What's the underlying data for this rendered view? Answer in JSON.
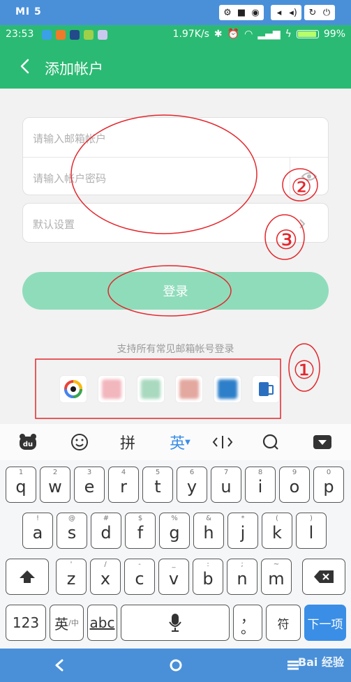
{
  "emulator": {
    "title": "MI 5"
  },
  "status_bar": {
    "time": "23:53",
    "speed": "1.97K/s",
    "battery": "99%",
    "battery_level": 0.99
  },
  "app_bar": {
    "title": "添加帐户"
  },
  "form": {
    "email_placeholder": "请输入邮箱帐户",
    "password_placeholder": "请输入帐户密码",
    "settings_label": "默认设置"
  },
  "login_button": "登录",
  "support_text": "支持所有常见邮箱帐号登录",
  "providers": [
    {
      "name": "provider-1",
      "color": "#e94335"
    },
    {
      "name": "provider-2",
      "color": "#f2b6bd"
    },
    {
      "name": "provider-3",
      "color": "#a9d9bf"
    },
    {
      "name": "provider-4",
      "color": "#e3a8a0"
    },
    {
      "name": "provider-5",
      "color": "#2d7fc9"
    },
    {
      "name": "provider-6",
      "color": "#2a6fbf"
    }
  ],
  "annotations": [
    "①",
    "②",
    "③"
  ],
  "keyboard": {
    "toolbar": {
      "pinyin": "拼",
      "english": "英"
    },
    "row1": [
      {
        "main": "q",
        "sub": "1"
      },
      {
        "main": "w",
        "sub": "2"
      },
      {
        "main": "e",
        "sub": "3"
      },
      {
        "main": "r",
        "sub": "4"
      },
      {
        "main": "t",
        "sub": "5"
      },
      {
        "main": "y",
        "sub": "6"
      },
      {
        "main": "u",
        "sub": "7"
      },
      {
        "main": "i",
        "sub": "8"
      },
      {
        "main": "o",
        "sub": "9"
      },
      {
        "main": "p",
        "sub": "0"
      }
    ],
    "row2": [
      {
        "main": "a",
        "sub": "!"
      },
      {
        "main": "s",
        "sub": "@"
      },
      {
        "main": "d",
        "sub": "#"
      },
      {
        "main": "f",
        "sub": "$"
      },
      {
        "main": "g",
        "sub": "%"
      },
      {
        "main": "h",
        "sub": "&"
      },
      {
        "main": "j",
        "sub": "*"
      },
      {
        "main": "k",
        "sub": "("
      },
      {
        "main": "l",
        "sub": ")"
      }
    ],
    "row3": [
      {
        "main": "z",
        "sub": "'"
      },
      {
        "main": "x",
        "sub": "/"
      },
      {
        "main": "c",
        "sub": "-"
      },
      {
        "main": "v",
        "sub": "_"
      },
      {
        "main": "b",
        "sub": ":"
      },
      {
        "main": "n",
        "sub": ";"
      },
      {
        "main": "m",
        "sub": "~"
      }
    ],
    "bottom": {
      "num": "123",
      "lang": "英",
      "lang_sub": "/中",
      "abc": "abc",
      "punct_top": "，",
      "punct_bottom": "。",
      "symbol": "符",
      "next": "下一项"
    }
  },
  "watermark": "Bai 经验"
}
